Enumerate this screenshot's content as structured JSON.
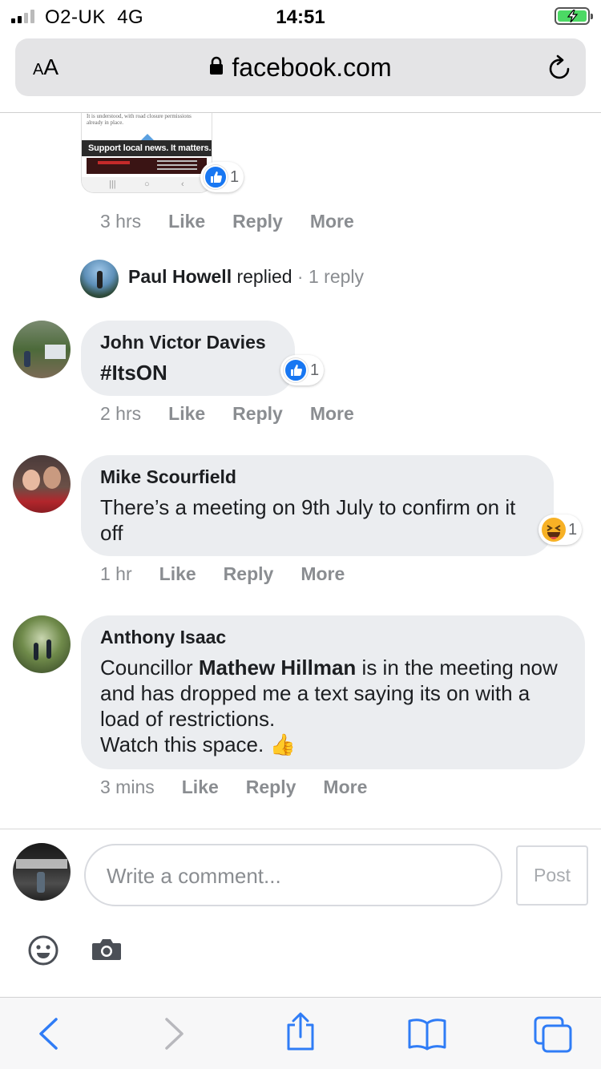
{
  "status_bar": {
    "carrier": "O2-UK",
    "network": "4G",
    "time": "14:51",
    "battery_state": "charging"
  },
  "browser": {
    "text_size_label": "AA",
    "domain": "facebook.com",
    "lock_icon": "lock-icon",
    "reload_icon": "reload-icon"
  },
  "embedded_preview": {
    "caption": "It is understood, with road closure permissions already in place.",
    "banner": "Support local news. It matters.",
    "reaction_count": "1"
  },
  "comment_top_meta": {
    "time": "3 hrs",
    "like": "Like",
    "reply": "Reply",
    "more": "More"
  },
  "reply_summary": {
    "name": "Paul Howell",
    "action": "replied",
    "separator": "·",
    "count": "1 reply"
  },
  "comments": [
    {
      "author": "John Victor Davies",
      "text": "#ItsON",
      "time": "2 hrs",
      "like": "Like",
      "reply": "Reply",
      "more": "More",
      "reaction": "like",
      "reaction_count": "1"
    },
    {
      "author": "Mike Scourfield",
      "text": "There’s a meeting on 9th July to confirm on it off",
      "time": "1 hr",
      "like": "Like",
      "reply": "Reply",
      "more": "More",
      "reaction": "haha",
      "reaction_count": "1"
    },
    {
      "author": "Anthony Isaac",
      "text_before": "Councillor ",
      "mention": "Mathew Hillman",
      "text_after": " is in the meeting now and has dropped me a text saying its on with a load of restrictions.",
      "text_line2": "Watch this space.",
      "emoji": "👍",
      "time": "3 mins",
      "like": "Like",
      "reply": "Reply",
      "more": "More"
    }
  ],
  "composer": {
    "placeholder": "Write a comment...",
    "post_label": "Post",
    "emoji_icon": "smiley-icon",
    "camera_icon": "camera-icon"
  },
  "toolbar": {
    "icons": [
      "back-icon",
      "forward-icon",
      "share-icon",
      "bookmarks-icon",
      "tabs-icon"
    ]
  },
  "colors": {
    "accent": "#1877f2",
    "bubble": "#ebedf0",
    "muted_text": "#8a8d91",
    "safari_blue": "#2f7cf6"
  }
}
